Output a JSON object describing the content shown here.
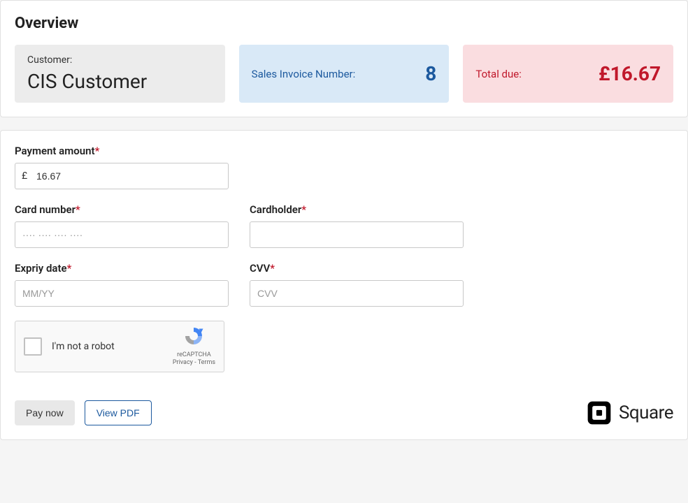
{
  "overview": {
    "title": "Overview",
    "customer": {
      "label": "Customer:",
      "value": "CIS Customer"
    },
    "invoice": {
      "label": "Sales Invoice Number:",
      "value": "8"
    },
    "total": {
      "label": "Total due:",
      "value": "£16.67"
    }
  },
  "form": {
    "payment_amount": {
      "label": "Payment amount",
      "currency": "£",
      "value": "16.67"
    },
    "card_number": {
      "label": "Card number",
      "placeholder": "···· ···· ···· ····"
    },
    "cardholder": {
      "label": "Cardholder"
    },
    "expiry": {
      "label": "Expriy date",
      "placeholder": "MM/YY"
    },
    "cvv": {
      "label": "CVV",
      "placeholder": "CVV"
    }
  },
  "recaptcha": {
    "label": "I'm not a robot",
    "brand": "reCAPTCHA",
    "legal": "Privacy - Terms"
  },
  "actions": {
    "pay_now": "Pay now",
    "view_pdf": "View PDF"
  },
  "brand": {
    "name": "Square"
  }
}
